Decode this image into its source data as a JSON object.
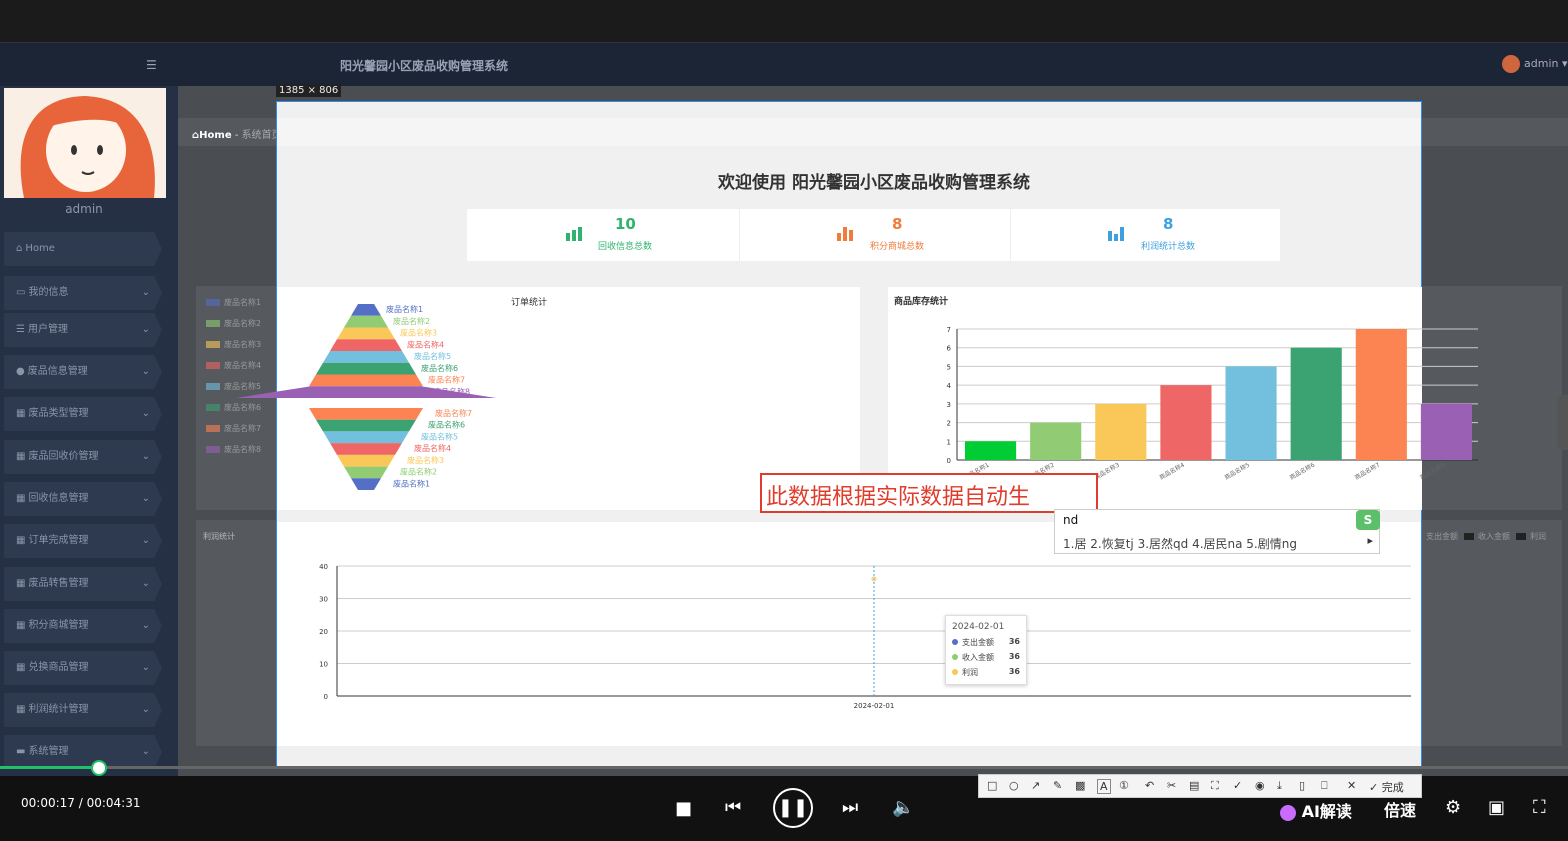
{
  "app": {
    "title": "阳光馨园小区废品收购管理系统",
    "user": "admin",
    "user_label": "admin"
  },
  "sidebar": {
    "username": "admin",
    "items": [
      {
        "label": "Home",
        "icon": "home-icon"
      },
      {
        "label": "我的信息",
        "icon": "card-icon"
      },
      {
        "label": "用户管理",
        "icon": "list-icon"
      },
      {
        "label": "废品信息管理",
        "icon": "person-icon"
      },
      {
        "label": "废品类型管理",
        "icon": "grid-icon"
      },
      {
        "label": "废品回收价管理",
        "icon": "grid-icon"
      },
      {
        "label": "回收信息管理",
        "icon": "grid-icon"
      },
      {
        "label": "订单完成管理",
        "icon": "calendar-icon"
      },
      {
        "label": "废品转售管理",
        "icon": "grid-icon"
      },
      {
        "label": "积分商城管理",
        "icon": "grid-icon"
      },
      {
        "label": "兑换商品管理",
        "icon": "grid-icon"
      },
      {
        "label": "利润统计管理",
        "icon": "grid-icon"
      },
      {
        "label": "系统管理",
        "icon": "monitor-icon"
      }
    ]
  },
  "breadcrumb": {
    "home": "Home",
    "sep": "-",
    "current": "系统首页"
  },
  "selection": {
    "size_label": "1385 × 806"
  },
  "welcome": "欢迎使用 阳光馨园小区废品收购管理系统",
  "stats": [
    {
      "value": "10",
      "label": "回收信息总数",
      "color": "#2fb36e"
    },
    {
      "value": "8",
      "label": "积分商城总数",
      "color": "#f07c3b"
    },
    {
      "value": "8",
      "label": "利润统计总数",
      "color": "#3ea0e0"
    }
  ],
  "left_legend": [
    "废品名称1",
    "废品名称2",
    "废品名称3",
    "废品名称4",
    "废品名称5",
    "废品名称6",
    "废品名称7",
    "废品名称8"
  ],
  "right_legend": [
    "支出金额",
    "收入金额",
    "利润"
  ],
  "chart_data": [
    {
      "type": "funnel",
      "title": "订单统计",
      "categories": [
        "废品名称1",
        "废品名称2",
        "废品名称3",
        "废品名称4",
        "废品名称5",
        "废品名称6",
        "废品名称7",
        "废品名称8"
      ],
      "colors": [
        "#5470c6",
        "#91cc75",
        "#fac858",
        "#ee6666",
        "#73c0de",
        "#3ba272",
        "#fc8452",
        "#9a60b4"
      ]
    },
    {
      "type": "bar",
      "title": "商品库存统计",
      "categories": [
        "商品名称1",
        "商品名称2",
        "商品名称3",
        "商品名称4",
        "商品名称5",
        "商品名称6",
        "商品名称7",
        "商品名称8"
      ],
      "values": [
        1,
        2,
        3,
        4,
        5,
        6,
        7,
        3
      ],
      "colors": [
        "#00cc33",
        "#91cc75",
        "#fac858",
        "#ee6666",
        "#73c0de",
        "#3ba272",
        "#fc8452",
        "#9a60b4"
      ],
      "ylim": [
        0,
        7
      ],
      "yticks": [
        "0",
        "1",
        "2",
        "3",
        "4",
        "5",
        "6",
        "7"
      ]
    },
    {
      "type": "line",
      "title": "利润统计",
      "x": [
        "2024-02-01"
      ],
      "series": [
        {
          "name": "支出金额",
          "values": [
            36
          ]
        },
        {
          "name": "收入金额",
          "values": [
            36
          ]
        },
        {
          "name": "利润",
          "values": [
            36
          ]
        }
      ],
      "ylim": [
        0,
        40
      ],
      "yticks": [
        "0",
        "10",
        "20",
        "30",
        "40"
      ],
      "tooltip": {
        "date": "2024-02-01",
        "rows": [
          {
            "name": "支出金额",
            "value": "36",
            "color": "#5470c6"
          },
          {
            "name": "收入金额",
            "value": "36",
            "color": "#91cc75"
          },
          {
            "name": "利润",
            "value": "36",
            "color": "#fac858"
          }
        ]
      }
    }
  ],
  "ime": {
    "composed": "此数据根据实际数据自动生",
    "code": "nd",
    "candidates": "1.居  2.恢复tj  3.居然qd  4.居民na  5.剧情ng"
  },
  "player": {
    "time": "00:00:17 / 00:04:31",
    "ai_label": "AI解读",
    "speed_label": "倍速",
    "progress": 0.063
  },
  "snip_toolbar": {
    "done": "完成"
  }
}
